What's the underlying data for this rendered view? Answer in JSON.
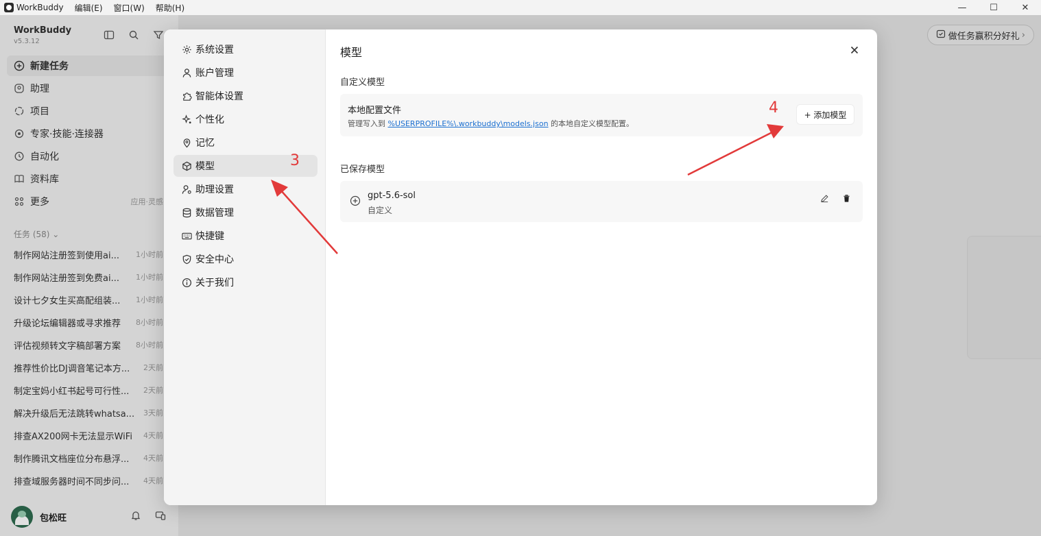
{
  "titlebar": {
    "app_name": "WorkBuddy",
    "menus": [
      "编辑(E)",
      "窗口(W)",
      "帮助(H)"
    ],
    "minimize": "—",
    "maximize": "☐",
    "close": "✕"
  },
  "sidebar": {
    "brand": "WorkBuddy",
    "version": "v5.3.12",
    "nav": [
      {
        "label": "新建任务",
        "icon": "plus-circle-icon"
      },
      {
        "label": "助理",
        "icon": "assistant-icon"
      },
      {
        "label": "项目",
        "icon": "project-icon"
      },
      {
        "label": "专家·技能·连接器",
        "icon": "expert-icon"
      },
      {
        "label": "自动化",
        "icon": "clock-icon"
      },
      {
        "label": "资料库",
        "icon": "book-icon"
      },
      {
        "label": "更多",
        "icon": "grid-icon",
        "extra": "应用·灵感"
      }
    ],
    "tasks_header": "任务 (58)",
    "tasks": [
      {
        "title": "制作网站注册签到使用ai...",
        "time": "1小时前"
      },
      {
        "title": "制作网站注册签到免费ai...",
        "time": "1小时前"
      },
      {
        "title": "设计七夕女生买高配组装...",
        "time": "1小时前"
      },
      {
        "title": "升级论坛编辑器或寻求推荐",
        "time": "8小时前"
      },
      {
        "title": "评估视频转文字稿部署方案",
        "time": "8小时前"
      },
      {
        "title": "推荐性价比DJ调音笔记本方...",
        "time": "2天前"
      },
      {
        "title": "制定宝妈小红书起号可行性...",
        "time": "2天前"
      },
      {
        "title": "解决升级后无法跳转whatsa...",
        "time": "3天前"
      },
      {
        "title": "排查AX200网卡无法显示WiFi",
        "time": "4天前"
      },
      {
        "title": "制作腾讯文档座位分布悬浮...",
        "time": "4天前"
      },
      {
        "title": "排查域服务器时间不同步问...",
        "time": "4天前"
      }
    ],
    "user_name": "包松旺"
  },
  "promo": {
    "label": "做任务赢积分好礼",
    "chevron": "›"
  },
  "settings": {
    "nav": [
      {
        "label": "系统设置",
        "icon": "gear-icon"
      },
      {
        "label": "账户管理",
        "icon": "user-icon"
      },
      {
        "label": "智能体设置",
        "icon": "puzzle-icon"
      },
      {
        "label": "个性化",
        "icon": "sparkle-icon"
      },
      {
        "label": "记忆",
        "icon": "pin-icon"
      },
      {
        "label": "模型",
        "icon": "cube-icon"
      },
      {
        "label": "助理设置",
        "icon": "user-gear-icon"
      },
      {
        "label": "数据管理",
        "icon": "database-icon"
      },
      {
        "label": "快捷键",
        "icon": "keyboard-icon"
      },
      {
        "label": "安全中心",
        "icon": "shield-icon"
      },
      {
        "label": "关于我们",
        "icon": "info-icon"
      }
    ],
    "active_index": 5,
    "title": "模型",
    "custom_section": {
      "label": "自定义模型",
      "card_title": "本地配置文件",
      "desc_prefix": "管理写入到 ",
      "desc_link": "%USERPROFILE%\\.workbuddy\\models.json",
      "desc_suffix": " 的本地自定义模型配置。",
      "add_button": "+ 添加模型"
    },
    "saved_section": {
      "label": "已保存模型",
      "models": [
        {
          "name": "gpt-5.6-sol",
          "type": "自定义"
        }
      ]
    }
  },
  "annotations": [
    {
      "number": "3",
      "color": "#e23a3a"
    },
    {
      "number": "4",
      "color": "#e23a3a"
    }
  ]
}
